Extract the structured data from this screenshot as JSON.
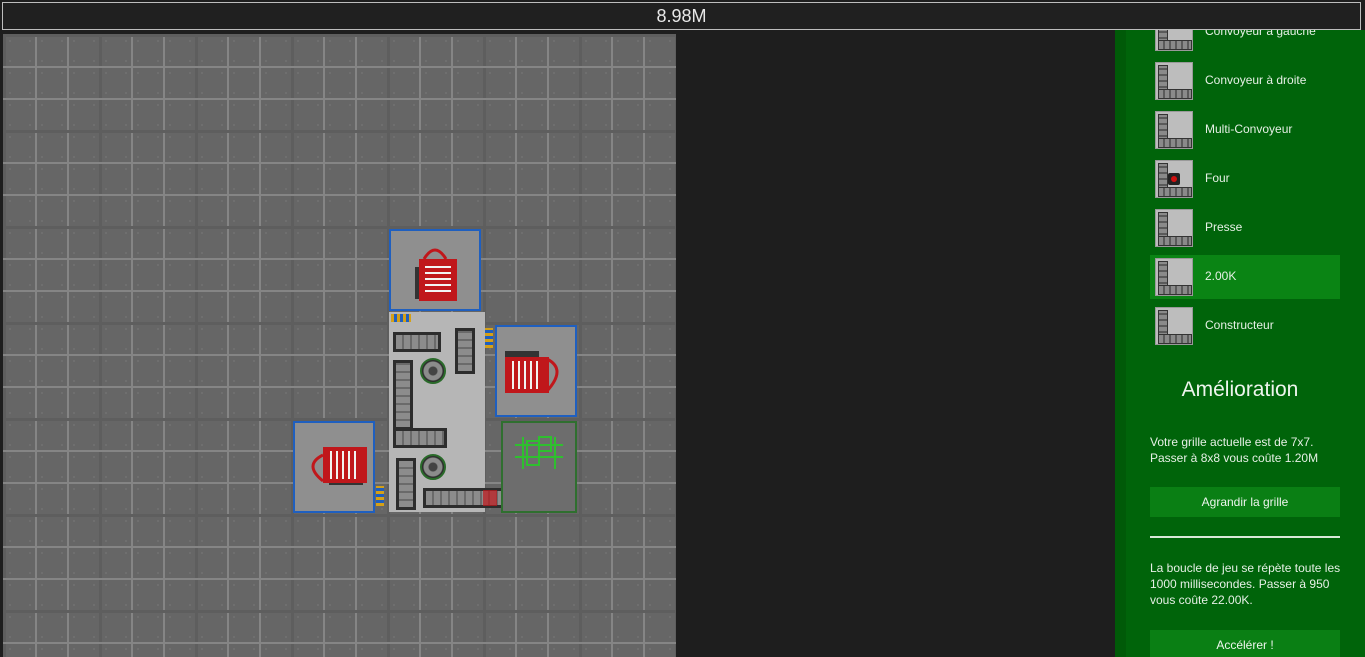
{
  "header": {
    "money": "8.98M"
  },
  "grid": {
    "size_label": "7x7"
  },
  "sidebar": {
    "items": [
      {
        "label": "Convoyeur à gauche",
        "icon": "belt-left-icon",
        "selected": false
      },
      {
        "label": "Convoyeur à droite",
        "icon": "belt-right-icon",
        "selected": false
      },
      {
        "label": "Multi-Convoyeur",
        "icon": "multi-belt-icon",
        "selected": false
      },
      {
        "label": "Four",
        "icon": "furnace-icon",
        "selected": false
      },
      {
        "label": "Presse",
        "icon": "press-icon",
        "selected": false
      },
      {
        "label": "2.00K",
        "icon": "crafter-icon",
        "selected": true
      },
      {
        "label": "Constructeur",
        "icon": "constructor-icon",
        "selected": false
      }
    ],
    "upgrade": {
      "title": "Amélioration",
      "grid_text": "Votre grille actuelle est de 7x7. Passer à 8x8 vous coûte 1.20M",
      "grid_button": "Agrandir la grille",
      "loop_text": "La boucle de jeu se répète toute les 1000 millisecondes. Passer à 950 vous coûte 22.00K.",
      "speed_button": "Accélérer !"
    }
  },
  "colors": {
    "sidebar_bg": "#00640a",
    "selected_bg": "#0a8414",
    "machine_border": "#1f5fbf",
    "item_red": "#c0171b"
  }
}
